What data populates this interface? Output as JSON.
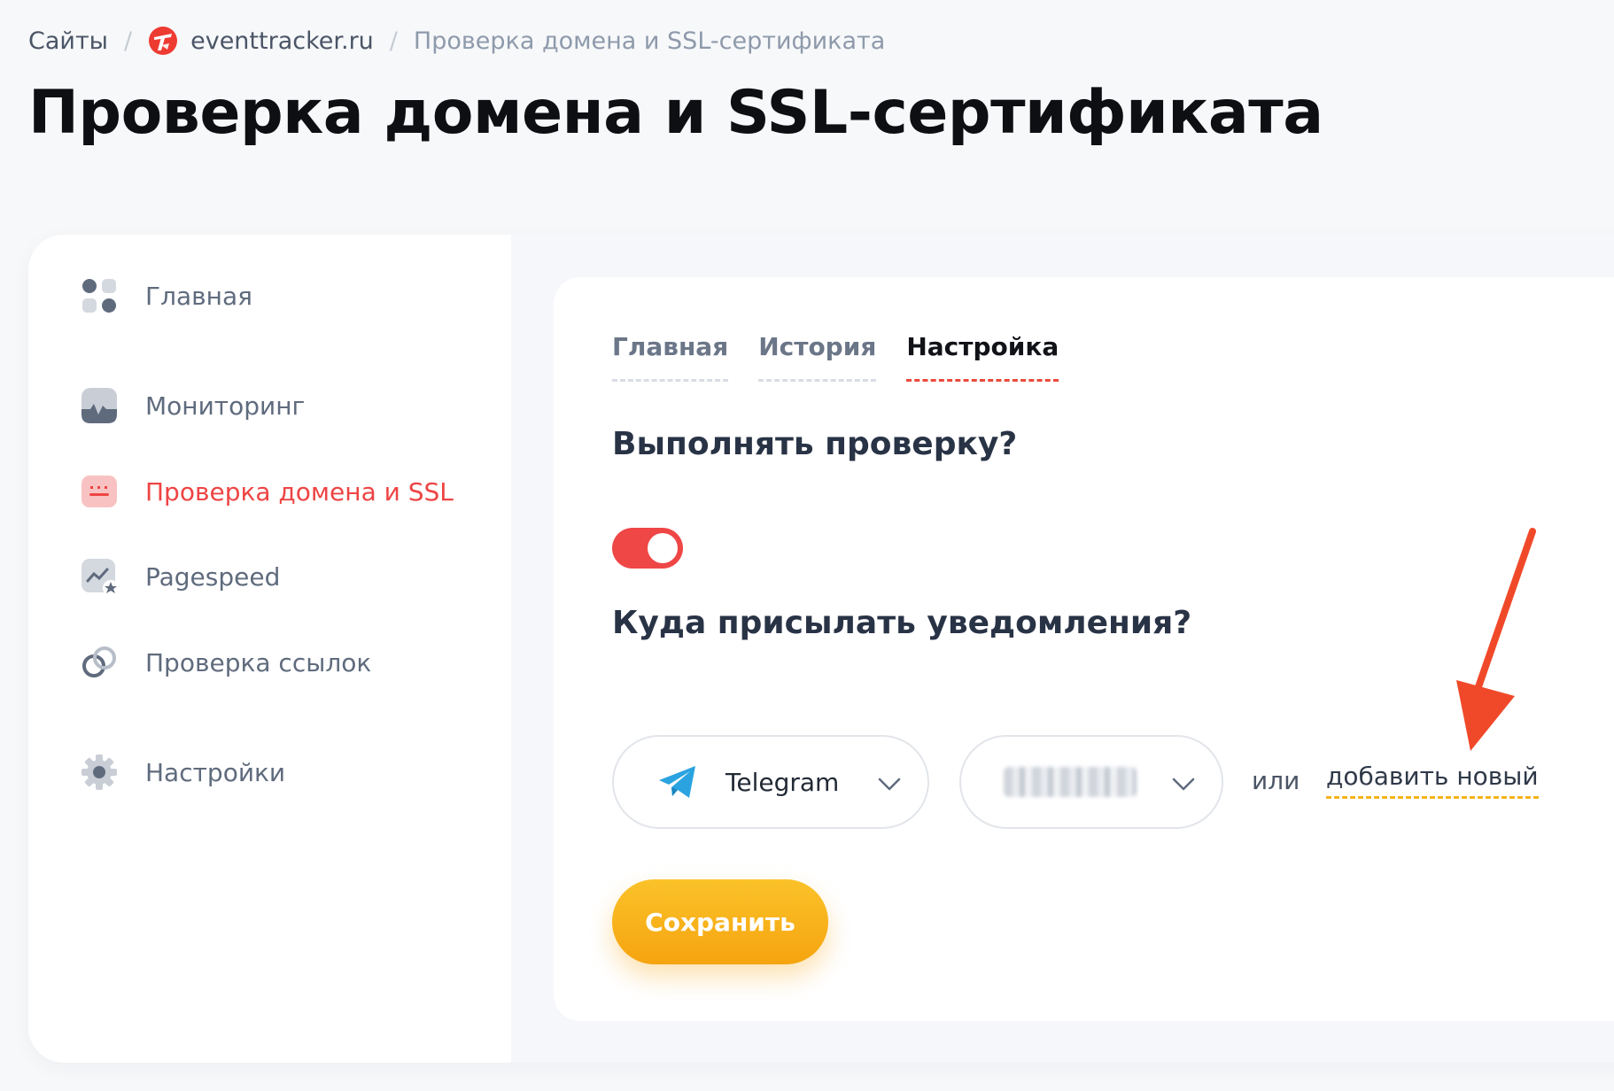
{
  "breadcrumb": {
    "sites": "Сайты",
    "separator": "/",
    "site": "eventtracker.ru",
    "current": "Проверка домена и SSL-сертификата"
  },
  "page": {
    "title": "Проверка домена и SSL-сертификата"
  },
  "sidebar": {
    "items": [
      {
        "label": "Главная",
        "icon": "dashboard-icon"
      },
      {
        "label": "Мониторинг",
        "icon": "monitoring-icon"
      },
      {
        "label": "Проверка домена и SSL",
        "icon": "ssl-icon",
        "active": true
      },
      {
        "label": "Pagespeed",
        "icon": "pagespeed-icon"
      },
      {
        "label": "Проверка ссылок",
        "icon": "link-icon"
      },
      {
        "label": "Настройки",
        "icon": "gear-icon"
      }
    ]
  },
  "tabs": [
    {
      "label": "Главная"
    },
    {
      "label": "История"
    },
    {
      "label": "Настройка",
      "active": true
    }
  ],
  "form": {
    "check_question": "Выполнять проверку?",
    "check_enabled": true,
    "notify_question": "Куда присылать уведомления?",
    "messenger": "Telegram",
    "or": "или",
    "add_new": "добавить новый",
    "save": "Сохранить"
  },
  "colors": {
    "accent_red": "#ef4646",
    "accent_yellow": "#f5a40f",
    "annotation_arrow": "#f0492a"
  }
}
